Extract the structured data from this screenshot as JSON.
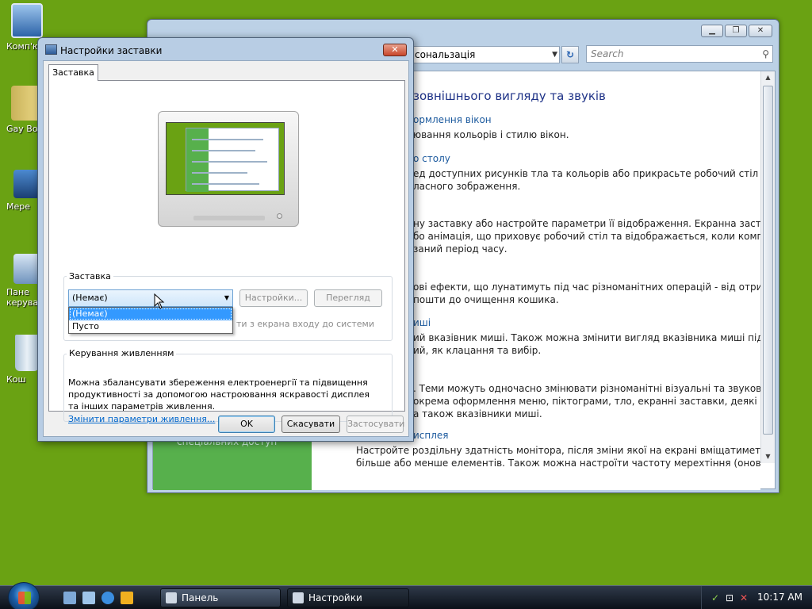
{
  "desktop": {
    "icons": [
      {
        "label": "Комп'ю",
        "icon": "computer-icon"
      },
      {
        "label": "Gay Bo",
        "icon": "folder-icon"
      },
      {
        "label": "Мере",
        "icon": "network-icon"
      },
      {
        "label": "Пане\nкерува",
        "icon": "control-panel-icon"
      },
      {
        "label": "Кош",
        "icon": "recycle-bin-icon"
      }
    ],
    "background_color": "#6aa213"
  },
  "control_panel": {
    "address": "сональзація",
    "search_placeholder": "Search",
    "heading": "зовнішнього вигляду та звуків",
    "green_panel_text": "спеціальних доступ",
    "items": [
      {
        "link": "ормлення вікон",
        "text": "ювання кольорів і стилю вікон."
      },
      {
        "link": "о столу",
        "text": "ед доступних рисунків тла та кольорів або прикрасьте робочий стіл за\nласного зображення."
      },
      {
        "link": "",
        "text": "ну заставку або настройте параметри її відображення. Екранна заставка –\nбо анімація, що приховує робочий стіл та відображається, коли комп'ютер\nзаний період часу."
      },
      {
        "link": "",
        "text": "ові ефекти, що лунатимуть під час різноманітних операцій - від отримання\nпошти до очищення кошика."
      },
      {
        "link": "иші",
        "text": "ий вказівник миші. Також можна змінити вигляд вказівника миші під час\nий, як клацання та вибір."
      },
      {
        "link": "",
        "text": ". Теми можуть одночасно змінювати різноманітні візуальні та звукові\nокрема оформлення меню, піктограми, тло, екранні заставки, деякі звуки\nа також вказівники миші."
      },
      {
        "link": "исплея",
        "text": "Настройте роздільну здатність монітора, після зміни якої на екрані вміщатиметься\nбільше або менше елементів. Також можна настроїти частоту мерехтіння (оновлення)"
      }
    ],
    "title_buttons": {
      "minimize": "▁",
      "maximize": "❐",
      "close": "✕"
    }
  },
  "dialog": {
    "title": "Настройки заставки",
    "tab_label": "Заставка",
    "screensaver_group_label": "Заставка",
    "combo_value": "(Немає)",
    "options": [
      "(Немає)",
      "Пусто"
    ],
    "settings_button": "Настройки...",
    "preview_button": "Перегляд",
    "resume_text": "ти з екрана входу до системи",
    "power_group_label": "Керування живленням",
    "power_text": "Можна збалансувати збереження електроенергії та підвищення продуктивності за допомогою настроювання яскравості дисплея та інших параметрів живлення.",
    "power_link": "Змінити параметри живлення...",
    "ok_button": "OK",
    "cancel_button": "Скасувати",
    "apply_button": "Застосувати",
    "close_glyph": "✕"
  },
  "taskbar": {
    "buttons": [
      {
        "label": "Панель керування\\...",
        "active": false
      },
      {
        "label": "Настройки заставки",
        "active": true
      }
    ],
    "clock": "10:17 AM",
    "quicklaunch": [
      "show-desktop-icon",
      "switch-windows-icon",
      "internet-explorer-icon",
      "media-player-icon"
    ]
  }
}
